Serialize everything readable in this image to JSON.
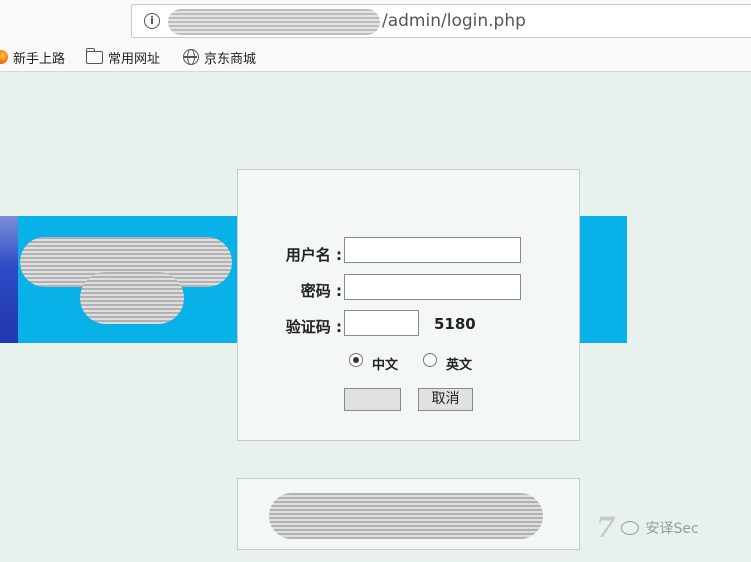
{
  "browser": {
    "url_suffix": "/admin/login.php",
    "bookmarks": [
      {
        "label": "新手上路",
        "icon": "firefox-icon"
      },
      {
        "label": "常用网址",
        "icon": "folder-icon"
      },
      {
        "label": "京东商城",
        "icon": "globe-icon"
      }
    ]
  },
  "login": {
    "username_label": "用户名 :",
    "password_label": "密码 :",
    "captcha_label": "验证码 :",
    "captcha_code": "5180",
    "language_options": [
      {
        "label": "中文",
        "selected": true
      },
      {
        "label": "英文",
        "selected": false
      }
    ],
    "submit_label": "",
    "cancel_label": "取消"
  },
  "watermark": {
    "mark": "7",
    "text": "安译Sec"
  },
  "colors": {
    "page_bg": "#e8f1ec",
    "banner": "#08b1e8"
  }
}
